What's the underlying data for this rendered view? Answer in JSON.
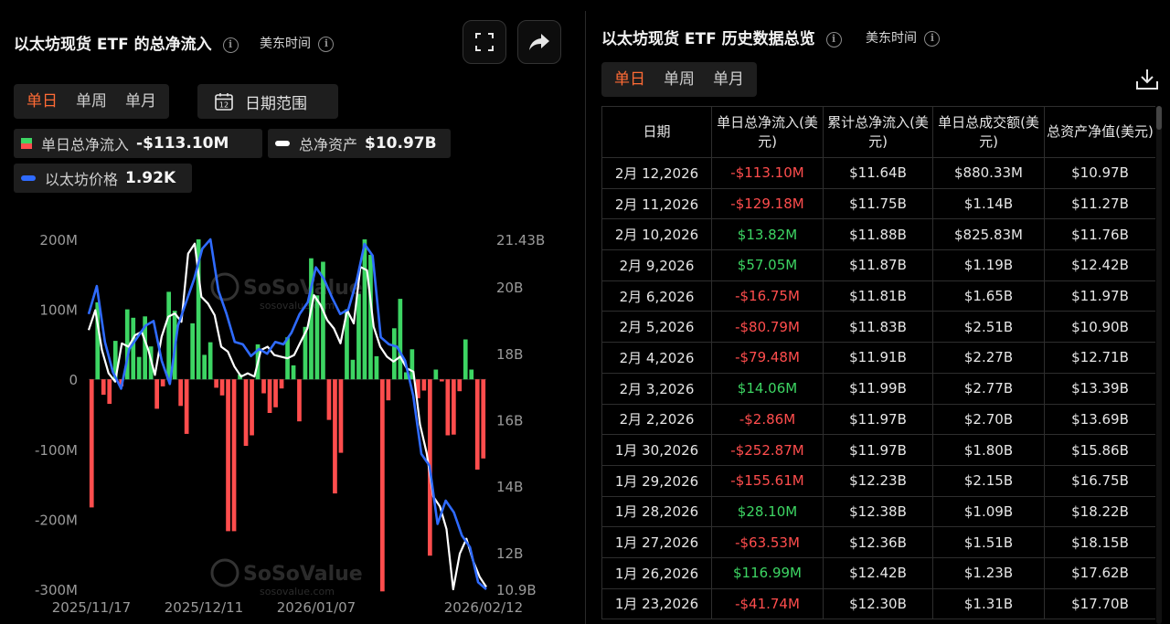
{
  "left": {
    "title": "以太坊现货 ETF 的总净流入",
    "timezone": "美东时间",
    "period_tabs": [
      "单日",
      "单周",
      "单月"
    ],
    "active_tab": "单日",
    "date_range_label": "日期范围",
    "date_range_icon_num": "12",
    "legend": {
      "flow_label": "单日总净流入",
      "flow_value": "-$113.10M",
      "assets_label": "总净资产",
      "assets_value": "$10.97B",
      "price_label": "以太坊价格",
      "price_value": "1.92K"
    },
    "watermark": "SoSoValue",
    "watermark_sub": "sosovalue.com"
  },
  "right": {
    "title": "以太坊现货 ETF 历史数据总览",
    "timezone": "美东时间",
    "period_tabs": [
      "单日",
      "单周",
      "单月"
    ],
    "active_tab": "单日",
    "columns": [
      "日期",
      "单日总净流入(美元)",
      "累计总净流入(美元)",
      "单日总成交额(美元)",
      "总资产净值(美元)"
    ],
    "rows": [
      [
        "2月 12,2026",
        "-$113.10M",
        "$11.64B",
        "$880.33M",
        "$10.97B"
      ],
      [
        "2月 11,2026",
        "-$129.18M",
        "$11.75B",
        "$1.14B",
        "$11.27B"
      ],
      [
        "2月 10,2026",
        "$13.82M",
        "$11.88B",
        "$825.83M",
        "$11.76B"
      ],
      [
        "2月 9,2026",
        "$57.05M",
        "$11.87B",
        "$1.19B",
        "$12.42B"
      ],
      [
        "2月 6,2026",
        "-$16.75M",
        "$11.81B",
        "$1.65B",
        "$11.97B"
      ],
      [
        "2月 5,2026",
        "-$80.79M",
        "$11.83B",
        "$2.51B",
        "$10.90B"
      ],
      [
        "2月 4,2026",
        "-$79.48M",
        "$11.91B",
        "$2.27B",
        "$12.71B"
      ],
      [
        "2月 3,2026",
        "$14.06M",
        "$11.99B",
        "$2.77B",
        "$13.39B"
      ],
      [
        "2月 2,2026",
        "-$2.86M",
        "$11.97B",
        "$2.70B",
        "$13.69B"
      ],
      [
        "1月 30,2026",
        "-$252.87M",
        "$11.97B",
        "$1.80B",
        "$15.86B"
      ],
      [
        "1月 29,2026",
        "-$155.61M",
        "$12.23B",
        "$2.15B",
        "$16.75B"
      ],
      [
        "1月 28,2026",
        "$28.10M",
        "$12.38B",
        "$1.09B",
        "$18.22B"
      ],
      [
        "1月 27,2026",
        "-$63.53M",
        "$12.36B",
        "$1.51B",
        "$18.15B"
      ],
      [
        "1月 26,2026",
        "$116.99M",
        "$12.42B",
        "$1.23B",
        "$17.62B"
      ],
      [
        "1月 23,2026",
        "-$41.74M",
        "$12.30B",
        "$1.31B",
        "$17.70B"
      ]
    ]
  },
  "colors": {
    "inflow": "#3dd563",
    "outflow": "#ff4d4d",
    "assets_line": "#ffffff",
    "price_line": "#2f6bff",
    "accent": "#ff6b35"
  },
  "chart_data": {
    "type": "bar",
    "title": "以太坊现货 ETF 的总净流入",
    "y_left_ticks": [
      "200M",
      "100M",
      "0",
      "-100M",
      "-200M",
      "-300M"
    ],
    "y_left_range": [
      -300,
      200
    ],
    "y_right_ticks": [
      "21.43B",
      "20B",
      "18B",
      "16B",
      "14B",
      "12B",
      "10.9B"
    ],
    "y_right_range": [
      10.9,
      21.43
    ],
    "x_tick_labels": [
      "2025/11/17",
      "2025/12/11",
      "2026/01/07",
      "2026/02/12"
    ],
    "series": [
      {
        "name": "单日总净流入",
        "type": "bar",
        "unit": "M USD",
        "values": [
          -183,
          110,
          -22,
          -35,
          55,
          -10,
          100,
          88,
          32,
          90,
          47,
          -42,
          -10,
          125,
          98,
          -38,
          -78,
          80,
          200,
          35,
          53,
          -12,
          -23,
          -217,
          -217,
          7,
          -95,
          -80,
          50,
          -20,
          -48,
          -40,
          -13,
          60,
          20,
          -60,
          75,
          173,
          120,
          168,
          -58,
          -163,
          -105,
          100,
          28,
          122,
          200,
          178,
          33,
          -303,
          -30,
          73,
          115,
          10,
          43,
          -27,
          -16,
          -252,
          14,
          -3,
          -80,
          -79,
          -17,
          57,
          14,
          -129,
          -113
        ]
      },
      {
        "name": "总净资产",
        "type": "line",
        "unit": "B USD",
        "values": [
          18.7,
          19.3,
          18.1,
          17.4,
          17.15,
          18.3,
          18.2,
          18.55,
          18.65,
          18.1,
          17.35,
          18.5,
          19.1,
          19.2,
          18.95,
          21.0,
          21.3,
          19.7,
          19.5,
          19.15,
          18.2,
          18.05,
          17.6,
          17.3,
          17.4,
          17.3,
          18.1,
          18.2,
          17.95,
          17.9,
          17.85,
          17.95,
          18.35,
          18.75,
          19.75,
          19.45,
          19.0,
          18.75,
          18.3,
          19.3,
          18.9,
          20.6,
          20.5,
          18.8,
          18.2,
          17.9,
          17.75,
          17.9,
          17.55,
          17.45,
          15.86,
          15.0,
          13.69,
          13.39,
          12.71,
          10.9,
          11.97,
          12.42,
          11.76,
          11.27,
          10.97
        ]
      },
      {
        "name": "以太坊价格",
        "type": "line",
        "unit": "K USD",
        "values": [
          3.1,
          3.22,
          2.98,
          2.85,
          2.78,
          2.95,
          3.0,
          3.05,
          3.07,
          2.9,
          2.8,
          3.05,
          3.15,
          3.25,
          3.38,
          3.42,
          3.2,
          3.1,
          2.98,
          2.97,
          2.92,
          2.95,
          2.93,
          2.98,
          2.97,
          3.02,
          3.1,
          3.15,
          3.3,
          3.25,
          3.17,
          3.1,
          3.12,
          3.24,
          3.4,
          3.35,
          3.0,
          2.97,
          2.96,
          2.9,
          2.75,
          2.5,
          2.45,
          2.2,
          2.3,
          2.25,
          2.15,
          2.1,
          1.95,
          1.92
        ]
      }
    ]
  }
}
